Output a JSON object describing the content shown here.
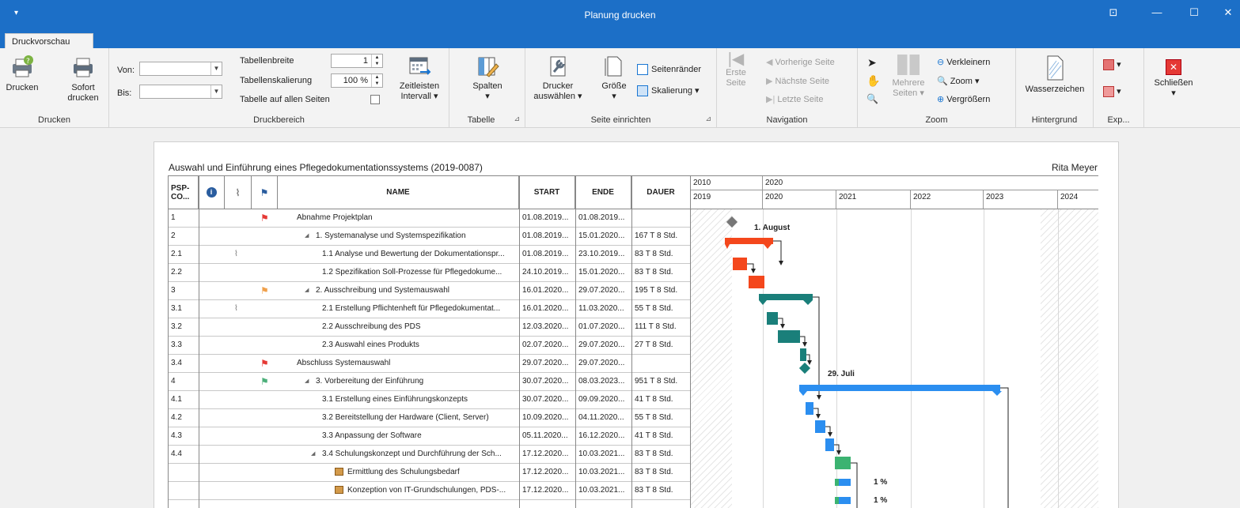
{
  "window": {
    "title": "Planung drucken",
    "qat_glyph": "▾",
    "controls": {
      "pin": "⊡",
      "minimize": "—",
      "maximize": "☐",
      "close": "✕"
    }
  },
  "ribbon": {
    "tab": "Druckvorschau",
    "drucken": {
      "btn_print": "Drucken",
      "btn_quick_1": "Sofort",
      "btn_quick_2": "drucken",
      "label": "Drucken"
    },
    "druckbereich": {
      "von_label": "Von:",
      "bis_label": "Bis:",
      "von_value": "",
      "bis_value": "",
      "tabellenbreite_label": "Tabellenbreite",
      "tabellenbreite_value": "1",
      "tabellenskalierung_label": "Tabellenskalierung",
      "tabellenskalierung_value": "100 %",
      "tabelle_alle_label": "Tabelle auf allen Seiten",
      "zeitleisten_1": "Zeitleisten",
      "zeitleisten_2": "Intervall ▾",
      "label": "Druckbereich"
    },
    "tabelle": {
      "spalten": "Spalten",
      "spalten_arrow": "▾",
      "label": "Tabelle"
    },
    "seite": {
      "drucker_1": "Drucker",
      "drucker_2": "auswählen ▾",
      "groesse_1": "Größe",
      "groesse_2": "▾",
      "seitenraender": "Seitenränder",
      "skalierung": "Skalierung ▾",
      "label": "Seite einrichten"
    },
    "navigation": {
      "erste_1": "Erste",
      "erste_2": "Seite",
      "vorherige": "Vorherige Seite",
      "naechste": "Nächste Seite",
      "letzte": "Letzte Seite",
      "label": "Navigation"
    },
    "zoom": {
      "mehrere_1": "Mehrere",
      "mehrere_2": "Seiten ▾",
      "verkleinern": "Verkleinern",
      "zoom": "Zoom",
      "zoom_arrow": "▾",
      "vergroessern": "Vergrößern",
      "label": "Zoom"
    },
    "hintergrund": {
      "wasserzeichen": "Wasserzeichen",
      "label": "Hintergrund"
    },
    "export": {
      "label": "Exp...",
      "arrow": "▾"
    },
    "schliessen": {
      "btn": "Schließen",
      "arrow": "▾"
    }
  },
  "page": {
    "title": "Auswahl und Einführung eines Pflegedokumentationssystems (2019-0087)",
    "owner": "Rita Meyer",
    "columns": {
      "psp_1": "PSP-",
      "psp_2": "CO...",
      "name": "NAME",
      "start": "START",
      "ende": "ENDE",
      "dauer": "DAUER"
    },
    "timeline": {
      "top": [
        {
          "label": "2010"
        },
        {
          "label": "2020"
        }
      ],
      "bottom": [
        {
          "label": "2019"
        },
        {
          "label": "2020"
        },
        {
          "label": "2021"
        },
        {
          "label": "2022"
        },
        {
          "label": "2023"
        },
        {
          "label": "2024"
        }
      ]
    },
    "rows": [
      {
        "code": "1",
        "flag": "red",
        "clip": false,
        "indent": 0,
        "expander": "",
        "icon": false,
        "name": "Abnahme Projektplan",
        "start": "01.08.2019...",
        "ende": "01.08.2019...",
        "dauer": ""
      },
      {
        "code": "2",
        "flag": "",
        "clip": false,
        "indent": 1,
        "expander": "◢",
        "icon": false,
        "name": "1. Systemanalyse und Systemspezifikation",
        "start": "01.08.2019...",
        "ende": "15.01.2020...",
        "dauer": "167 T 8 Std."
      },
      {
        "code": "2.1",
        "flag": "",
        "clip": true,
        "indent": 2,
        "expander": "",
        "icon": false,
        "name": "1.1 Analyse und Bewertung der Dokumentationspr...",
        "start": "01.08.2019...",
        "ende": "23.10.2019...",
        "dauer": "83 T 8 Std."
      },
      {
        "code": "2.2",
        "flag": "",
        "clip": false,
        "indent": 2,
        "expander": "",
        "icon": false,
        "name": "1.2 Spezifikation Soll-Prozesse für Pflegedokume...",
        "start": "24.10.2019...",
        "ende": "15.01.2020...",
        "dauer": "83 T 8 Std."
      },
      {
        "code": "3",
        "flag": "orange",
        "clip": false,
        "indent": 1,
        "expander": "◢",
        "icon": false,
        "name": "2. Ausschreibung und Systemauswahl",
        "start": "16.01.2020...",
        "ende": "29.07.2020...",
        "dauer": "195 T 8 Std."
      },
      {
        "code": "3.1",
        "flag": "",
        "clip": true,
        "indent": 2,
        "expander": "",
        "icon": false,
        "name": "2.1 Erstellung Pflichtenheft für Pflegedokumentat...",
        "start": "16.01.2020...",
        "ende": "11.03.2020...",
        "dauer": "55 T 8 Std."
      },
      {
        "code": "3.2",
        "flag": "",
        "clip": false,
        "indent": 2,
        "expander": "",
        "icon": false,
        "name": "2.2 Ausschreibung des PDS",
        "start": "12.03.2020...",
        "ende": "01.07.2020...",
        "dauer": "111 T 8 Std."
      },
      {
        "code": "3.3",
        "flag": "",
        "clip": false,
        "indent": 2,
        "expander": "",
        "icon": false,
        "name": "2.3 Auswahl eines Produkts",
        "start": "02.07.2020...",
        "ende": "29.07.2020...",
        "dauer": "27 T 8 Std."
      },
      {
        "code": "3.4",
        "flag": "red",
        "clip": false,
        "indent": 0,
        "expander": "",
        "icon": false,
        "name": "Abschluss Systemauswahl",
        "start": "29.07.2020...",
        "ende": "29.07.2020...",
        "dauer": ""
      },
      {
        "code": "4",
        "flag": "green",
        "clip": false,
        "indent": 1,
        "expander": "◢",
        "icon": false,
        "name": "3. Vorbereitung der Einführung",
        "start": "30.07.2020...",
        "ende": "08.03.2023...",
        "dauer": "951 T 8 Std."
      },
      {
        "code": "4.1",
        "flag": "",
        "clip": false,
        "indent": 2,
        "expander": "",
        "icon": false,
        "name": "3.1 Erstellung eines Einführungskonzepts",
        "start": "30.07.2020...",
        "ende": "09.09.2020...",
        "dauer": "41 T 8 Std."
      },
      {
        "code": "4.2",
        "flag": "",
        "clip": false,
        "indent": 2,
        "expander": "",
        "icon": false,
        "name": "3.2 Bereitstellung der Hardware (Client, Server)",
        "start": "10.09.2020...",
        "ende": "04.11.2020...",
        "dauer": "55 T 8 Std."
      },
      {
        "code": "4.3",
        "flag": "",
        "clip": false,
        "indent": 2,
        "expander": "",
        "icon": false,
        "name": "3.3 Anpassung der Software",
        "start": "05.11.2020...",
        "ende": "16.12.2020...",
        "dauer": "41 T 8 Std."
      },
      {
        "code": "4.4",
        "flag": "",
        "clip": false,
        "indent": 2,
        "expander": "◢",
        "icon": false,
        "name": "3.4 Schulungskonzept und Durchführung der Sch...",
        "start": "17.12.2020...",
        "ende": "10.03.2021...",
        "dauer": "83 T 8 Std."
      },
      {
        "code": "",
        "flag": "",
        "clip": false,
        "indent": 3,
        "expander": "",
        "icon": true,
        "name": "Ermittlung des Schulungsbedarf",
        "start": "17.12.2020...",
        "ende": "10.03.2021...",
        "dauer": "83 T 8 Std."
      },
      {
        "code": "",
        "flag": "",
        "clip": false,
        "indent": 3,
        "expander": "",
        "icon": true,
        "name": "Konzeption von IT-Grundschulungen, PDS-...",
        "start": "17.12.2020...",
        "ende": "10.03.2021...",
        "dauer": "83 T 8 Std."
      }
    ],
    "gantt_labels": {
      "m1": "1. August",
      "m2": "29. Juli",
      "p1": "1 %",
      "p2": "1 %"
    },
    "colors": {
      "red": "#f4471c",
      "teal": "#1a7f7a",
      "blue": "#2b8ef0",
      "green": "#3cb371",
      "flag_red": "#e53935",
      "flag_orange": "#f0a04b",
      "flag_green": "#4caf7a",
      "titlebar": "#1c6fc7"
    }
  }
}
